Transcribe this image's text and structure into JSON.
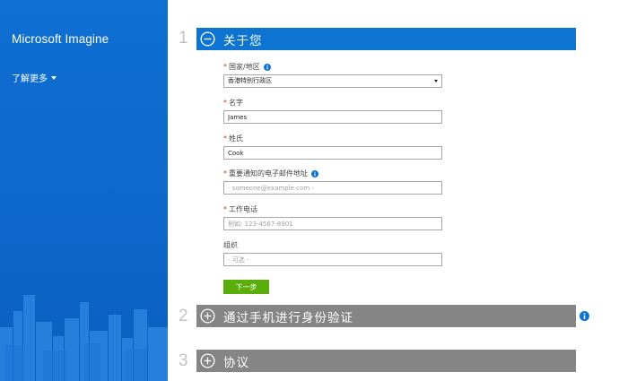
{
  "sidebar": {
    "brand": "Microsoft Imagine",
    "learn_more": "了解更多"
  },
  "sections": [
    {
      "number": "1",
      "title": "关于您",
      "state": "expanded",
      "icon": "minus-circle-icon"
    },
    {
      "number": "2",
      "title": "通过手机进行身份验证",
      "state": "collapsed",
      "icon": "plus-circle-icon"
    },
    {
      "number": "3",
      "title": "协议",
      "state": "collapsed",
      "icon": "plus-circle-icon"
    }
  ],
  "form": {
    "country": {
      "label": "国家/地区",
      "required": "*",
      "value": "香港特别行政区"
    },
    "first_name": {
      "label": "名字",
      "required": "*",
      "value": "James"
    },
    "last_name": {
      "label": "姓氏",
      "required": "*",
      "value": "Cook"
    },
    "email": {
      "label": "重要通知的电子邮件地址",
      "required": "*",
      "value": "",
      "placeholder": "- someone@example.com -"
    },
    "phone": {
      "label": "工作电话",
      "required": "*",
      "value": "",
      "placeholder": "例如: 123-4567-8901"
    },
    "org": {
      "label": "组织",
      "value": "",
      "placeholder": "- 可选 -"
    },
    "next_label": "下一步"
  },
  "colors": {
    "sidebar_bg": "#0e6ecf",
    "active_header": "#0e74d2",
    "collapsed_header": "#858585",
    "next_button": "#5bad0a",
    "required": "#d83b01",
    "info": "#0e74d2"
  }
}
